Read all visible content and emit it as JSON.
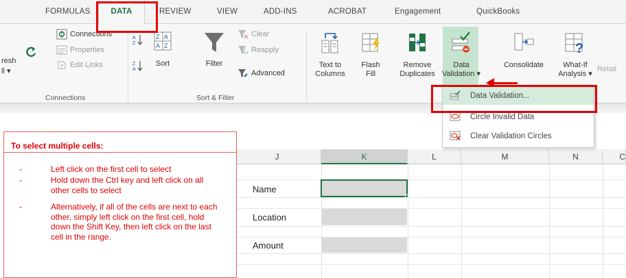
{
  "tabs": {
    "formulas": "FORMULAS",
    "data": "DATA",
    "review": "REVIEW",
    "view": "VIEW",
    "addins": "ADD-INS",
    "acrobat": "ACROBAT",
    "engagement": "Engagement",
    "quickbooks": "QuickBooks"
  },
  "connections_group": {
    "refresh_label_1": "resh",
    "refresh_label_2": "ll ▾",
    "connections": "Connections",
    "properties": "Properties",
    "edit_links": "Edit Links",
    "group_label": "Connections"
  },
  "sort_filter_group": {
    "sort": "Sort",
    "filter": "Filter",
    "clear": "Clear",
    "reapply": "Reapply",
    "advanced": "Advanced",
    "group_label": "Sort & Filter"
  },
  "data_tools_group": {
    "text_to_columns_1": "Text to",
    "text_to_columns_2": "Columns",
    "flash_fill_1": "Flash",
    "flash_fill_2": "Fill",
    "remove_duplicates_1": "Remove",
    "remove_duplicates_2": "Duplicates",
    "data_validation_1": "Data",
    "data_validation_2": "Validation ▾",
    "consolidate": "Consolidate",
    "what_if_1": "What-If",
    "what_if_2": "Analysis ▾",
    "relationships": "Relati"
  },
  "data_validation_menu": {
    "items": [
      {
        "label": "Data Validation...",
        "accel": "V"
      },
      {
        "label": "Circle Invalid Data",
        "accel": "I"
      },
      {
        "label": "Clear Validation Circles",
        "accel": "R"
      }
    ]
  },
  "sheet": {
    "columns": [
      "J",
      "K",
      "L",
      "M",
      "N",
      "C"
    ],
    "selected_column": "K",
    "rows": [
      {
        "label": "Name"
      },
      {
        "label": "Location"
      },
      {
        "label": "Amount"
      }
    ]
  },
  "note": {
    "title": "To select multiple cells:",
    "items": [
      {
        "dash": "-",
        "text": "Left click on the first cell to select"
      },
      {
        "dash": "-",
        "text": "Hold down the Ctrl key and left click on all other cells to select"
      },
      {
        "dash": "-",
        "text": "Alternatively, if all of the cells are next to each other, simply left click on the first cell, hold down the Shift Key, then left click on the last cell in the range."
      }
    ]
  },
  "colors": {
    "accent_green": "#217346",
    "annotation_red": "#e00000",
    "highlight_green": "#c6e3cf"
  }
}
